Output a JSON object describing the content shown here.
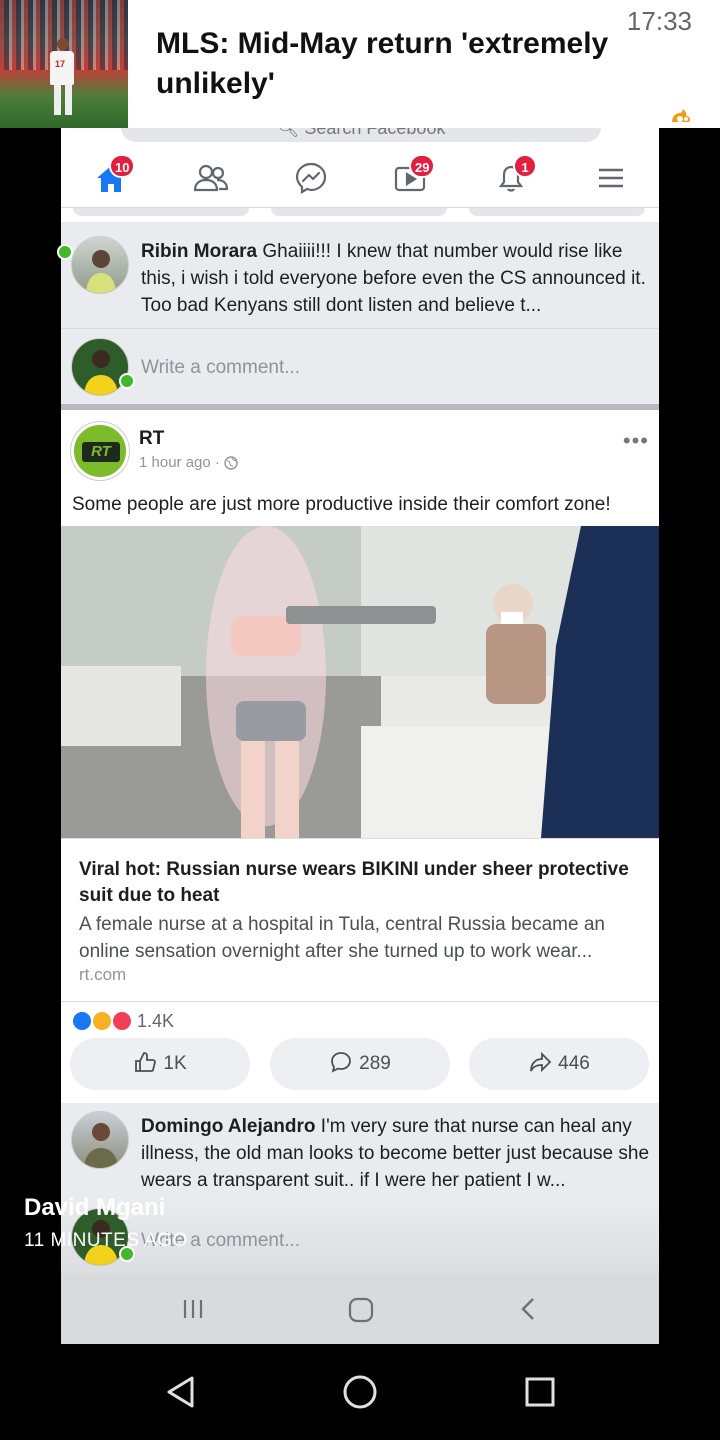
{
  "notification": {
    "title": "MLS: Mid-May return 'extremely unlikely'",
    "time": "17:33",
    "thumb_jersey_number": "17"
  },
  "facebook": {
    "search_placeholder": "Search Facebook",
    "tabs": [
      {
        "name": "home",
        "badge": "10"
      },
      {
        "name": "friends",
        "badge": ""
      },
      {
        "name": "messenger",
        "badge": ""
      },
      {
        "name": "watch",
        "badge": "29"
      },
      {
        "name": "notifications",
        "badge": "1"
      },
      {
        "name": "menu",
        "badge": ""
      }
    ],
    "accent": "#1877f2",
    "badge_color": "#e41e3f"
  },
  "comment1": {
    "author": "Ribin Morara",
    "text": " Ghaiiii!!! I knew that number would rise like this, i wish i told everyone before even the CS announced it. Too bad Kenyans still dont listen and believe t..."
  },
  "write_comment_placeholder": "Write a comment...",
  "post": {
    "author": "RT",
    "logo_text": "RT",
    "time": "1 hour ago",
    "more": "•••",
    "text": "Some people are just more productive inside their comfort zone!",
    "link_title": "Viral hot: Russian nurse wears BIKINI under sheer protective suit due to heat",
    "link_desc": "A female nurse at a hospital in Tula, central Russia became an online sensation overnight after she turned up to work wear...",
    "link_domain": "rt.com",
    "reaction_count": "1.4K",
    "like_count": "1K",
    "comment_count": "289",
    "share_count": "446"
  },
  "comment2": {
    "author": "Domingo Alejandro",
    "text": " I'm very sure that nurse can heal any illness, the old man looks to become better just because she wears a transparent suit.. if I were her patient I w..."
  },
  "overlay": {
    "name": "David Mgani",
    "time": "11 MINUTES AGO"
  }
}
